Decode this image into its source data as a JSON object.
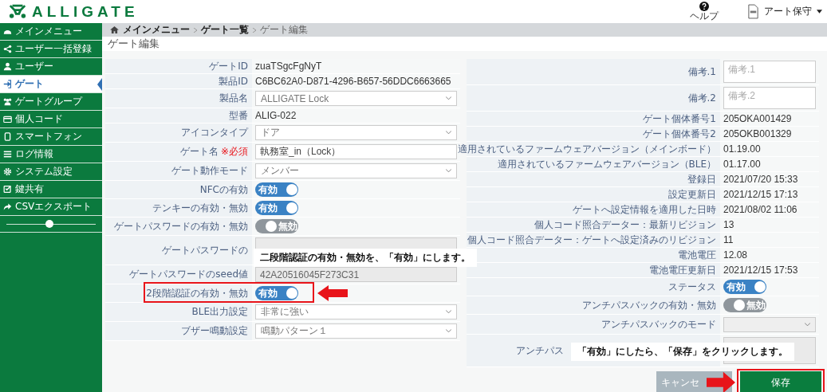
{
  "header": {
    "logo": "ALLIGATE",
    "help": "ヘルプ",
    "user": "アート保守"
  },
  "sidebar": {
    "items": [
      {
        "label": "メインメニュー",
        "selected": false
      },
      {
        "label": "ユーザー一括登録",
        "selected": false
      },
      {
        "label": "ユーザー",
        "selected": false
      },
      {
        "label": "ゲート",
        "selected": true
      },
      {
        "label": "ゲートグループ",
        "selected": false
      },
      {
        "label": "個人コード",
        "selected": false
      },
      {
        "label": "スマートフォン",
        "selected": false
      },
      {
        "label": "ログ情報",
        "selected": false
      },
      {
        "label": "システム設定",
        "selected": false
      },
      {
        "label": "鍵共有",
        "selected": false
      },
      {
        "label": "CSVエクスポート",
        "selected": false
      }
    ],
    "slider": {
      "level": 0.48
    }
  },
  "breadcrumb": [
    {
      "label": "メインメニュー",
      "current": false
    },
    {
      "label": "ゲート一覧",
      "current": false
    },
    {
      "label": "ゲート編集",
      "current": true
    }
  ],
  "page_title": "ゲート編集",
  "left_form": [
    {
      "label": "ゲートID",
      "kind": "text",
      "value": "zuaTSgcFgNyT"
    },
    {
      "label": "製品ID",
      "kind": "text",
      "value": "C6BC62A0-D871-4296-B657-56DDC6663665"
    },
    {
      "label": "製品名",
      "kind": "select",
      "value": "ALLIGATE Lock"
    },
    {
      "label": "型番",
      "kind": "text",
      "value": "ALIG-022"
    },
    {
      "label": "アイコンタイプ",
      "kind": "select",
      "value": "ドア"
    },
    {
      "label": "ゲート名",
      "required": "※必須",
      "kind": "input",
      "value": "執務室_in（Lock）"
    },
    {
      "label": "ゲート動作モード",
      "kind": "select",
      "value": "メンバー"
    },
    {
      "label": "NFCの有効",
      "kind": "toggle",
      "on": true,
      "value": "有効"
    },
    {
      "label": "テンキーの有効・無効",
      "kind": "toggle",
      "on": true,
      "value": "有効"
    },
    {
      "label": "ゲートパスワードの有効・無効",
      "kind": "toggle",
      "on": false,
      "value": "無効"
    },
    {
      "label": "ゲートパスワードの",
      "kind": "disabled"
    },
    {
      "label": "ゲートパスワードのseed値",
      "kind": "disabled",
      "value": "42A20516045F273C31"
    },
    {
      "label": "2段階認証の有効・無効",
      "kind": "toggle",
      "on": true,
      "value": "有効",
      "highlighted": true
    },
    {
      "label": "BLE出力設定",
      "kind": "select",
      "value": "非常に強い"
    },
    {
      "label": "ブザー鳴動設定",
      "kind": "select",
      "value": "鳴動パターン１"
    }
  ],
  "right_form": [
    {
      "label": "備考.1",
      "kind": "textarea",
      "placeholder": "備考.1"
    },
    {
      "label": "備考.2",
      "kind": "textarea",
      "placeholder": "備考.2"
    },
    {
      "label": "ゲート個体番号1",
      "kind": "text",
      "value": "205OKA001429"
    },
    {
      "label": "ゲート個体番号2",
      "kind": "text",
      "value": "205OKB001329"
    },
    {
      "label": "適用されているファームウェアバージョン（メインボード）",
      "kind": "text",
      "value": "01.19.00"
    },
    {
      "label": "適用されているファームウェアバージョン（BLE）",
      "kind": "text",
      "value": "01.17.00"
    },
    {
      "label": "登録日",
      "kind": "text",
      "value": "2021/07/20 15:33"
    },
    {
      "label": "設定更新日",
      "kind": "text",
      "value": "2021/12/15 17:13"
    },
    {
      "label": "ゲートへ設定情報を適用した日時",
      "kind": "text",
      "value": "2021/08/02 11:06"
    },
    {
      "label": "個人コード照合データー：最新リビジョン",
      "kind": "text",
      "value": "13"
    },
    {
      "label": "個人コード照合データー：ゲートへ設定済みのリビジョン",
      "kind": "text",
      "value": "11"
    },
    {
      "label": "電池電圧",
      "kind": "text",
      "value": "12.08"
    },
    {
      "label": "電池電圧更新日",
      "kind": "text",
      "value": "2021/12/15 17:53"
    },
    {
      "label": "ステータス",
      "kind": "toggle",
      "on": true,
      "value": "有効"
    },
    {
      "label": "アンチパスバックの有効・無効",
      "kind": "toggle",
      "on": false,
      "value": "無効"
    },
    {
      "label": "アンチパスバックのモード",
      "kind": "disabled_select"
    },
    {
      "label": "アンチパス",
      "kind": "disabled_textarea"
    }
  ],
  "buttons": [
    {
      "label": "キャンセ",
      "kind": "cancel",
      "highlighted": false
    },
    {
      "label": "保存",
      "kind": "save",
      "highlighted": true
    }
  ],
  "annotations": [
    {
      "text": "二段階認証の有効・無効を、「有効」にします。"
    },
    {
      "text": "「有効」にしたら、「保存」をクリックします。"
    }
  ]
}
